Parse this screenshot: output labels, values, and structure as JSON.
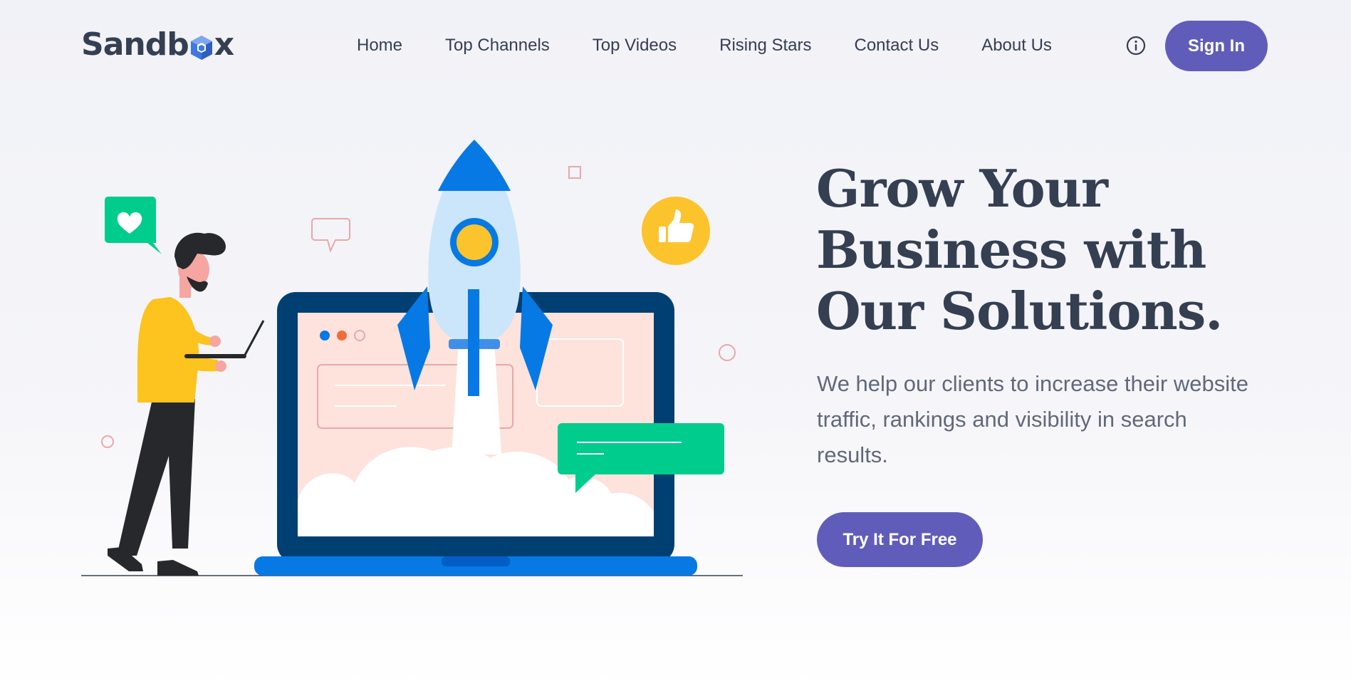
{
  "brand": {
    "name_part1": "Sandb",
    "name_part2": "x",
    "accent": "#605dba",
    "logo_icon": "cube-icon"
  },
  "nav": {
    "items": [
      "Home",
      "Top Channels",
      "Top Videos",
      "Rising Stars",
      "Contact Us",
      "About Us"
    ],
    "info_icon": "info-icon",
    "signin_label": "Sign In"
  },
  "hero": {
    "title": "Grow Your Business with Our Solutions.",
    "subtitle": "We help our clients to increase their website traffic, rankings and visibility in search results.",
    "cta_label": "Try It For Free"
  },
  "illustration": {
    "subject": "rocket-launch-illustration",
    "colors": {
      "laptop": "#003f72",
      "rocket": "#0779e4",
      "green": "#00cc8d",
      "yellow": "#fcc42c",
      "shirt": "#fdc31e"
    }
  }
}
